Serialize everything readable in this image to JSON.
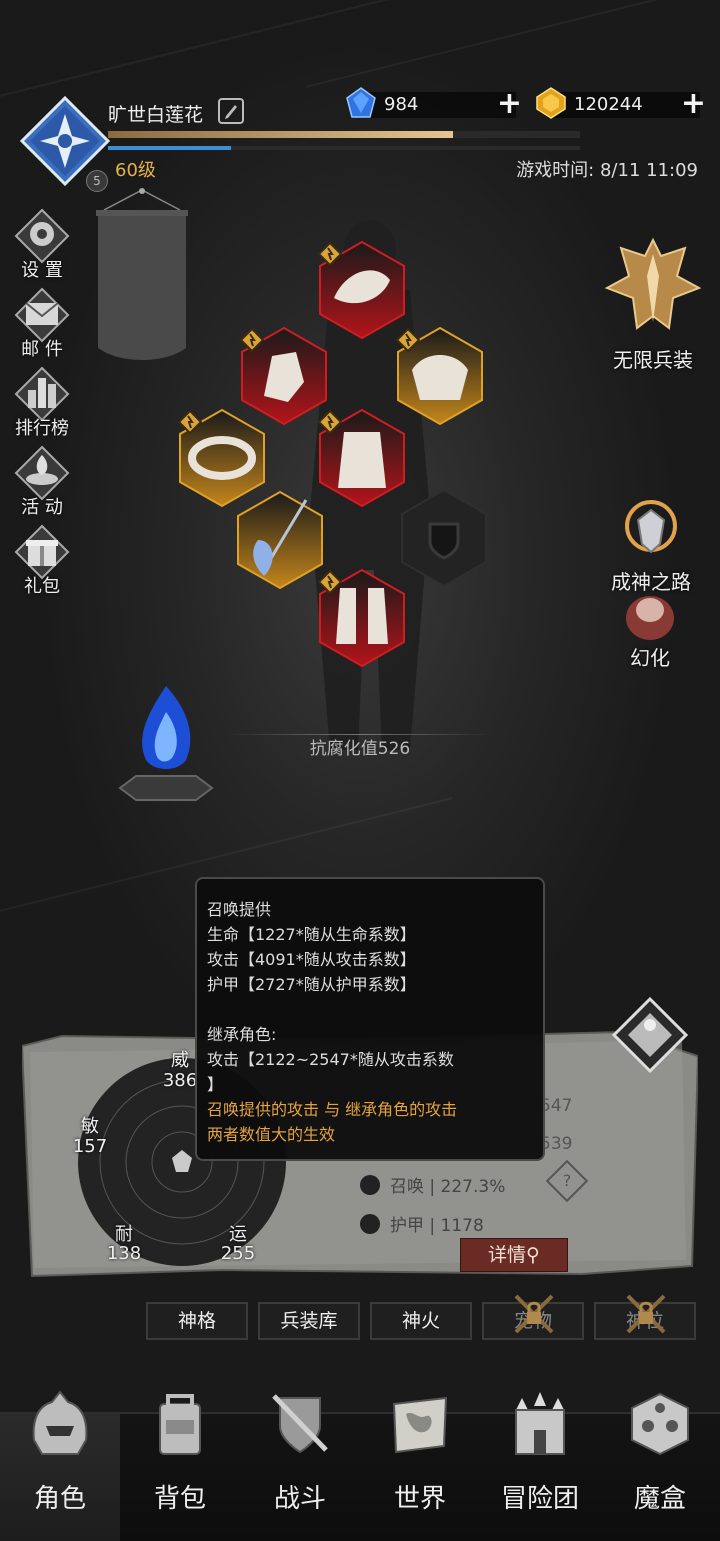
{
  "player": {
    "name": "旷世白莲花",
    "level_text": "60级",
    "badge": "5",
    "xp_fraction": 0.73,
    "mp_fraction": 0.26,
    "game_time": "游戏时间: 8/11 11:09"
  },
  "resources": {
    "diamonds": "984",
    "gold": "120244"
  },
  "left_menu": [
    {
      "label": "设 置",
      "icon": "gear-icon"
    },
    {
      "label": "邮 件",
      "icon": "mail-icon"
    },
    {
      "label": "排行榜",
      "icon": "ranking-icon"
    },
    {
      "label": "活 动",
      "icon": "event-icon"
    },
    {
      "label": "礼包",
      "icon": "gift-icon"
    }
  ],
  "right_menu": [
    {
      "label": "无限兵装",
      "icon": "infinite-arms-emblem"
    },
    {
      "label": "成神之路",
      "icon": "godhood-path-icon"
    },
    {
      "label": "幻化",
      "icon": "transmog-icon"
    }
  ],
  "equipment": {
    "corruption_resistance": "抗腐化值526"
  },
  "tooltip": {
    "title": "召唤提供",
    "line1": "生命【1227*随从生命系数】",
    "line2": "攻击【4091*随从攻击系数】",
    "line3": "护甲【2727*随从护甲系数】",
    "inherit_title": "继承角色:",
    "inherit_line1": "攻击【2122~2547*随从攻击系数",
    "inherit_line2": "】",
    "note1": "召唤提供的攻击 与 继承角色的攻击",
    "note2": "两者数值大的生效"
  },
  "stats": {
    "wei_label": "威",
    "wei_value": "386",
    "min_label": "敏",
    "min_value": "157",
    "nai_label": "耐",
    "nai_value": "138",
    "yun_label": "运",
    "yun_value": "255",
    "partial_1": "547",
    "partial_2": "539",
    "summon_label": "召唤 | 227.3%",
    "armor_label": "护甲 | 1178",
    "help": "?",
    "detail_button": "详情"
  },
  "tabs": [
    {
      "label": "神格",
      "locked": false
    },
    {
      "label": "兵装库",
      "locked": false
    },
    {
      "label": "神火",
      "locked": false
    },
    {
      "label": "宠物",
      "locked": true
    },
    {
      "label": "神位",
      "locked": true
    }
  ],
  "bottom_nav": [
    {
      "label": "角色",
      "icon": "helmet-icon",
      "active": true
    },
    {
      "label": "背包",
      "icon": "backpack-icon"
    },
    {
      "label": "战斗",
      "icon": "swords-shield-icon"
    },
    {
      "label": "世界",
      "icon": "map-scroll-icon"
    },
    {
      "label": "冒险团",
      "icon": "castle-icon"
    },
    {
      "label": "魔盒",
      "icon": "magic-cube-icon"
    }
  ],
  "colors": {
    "accent_gold": "#e3b34a",
    "rare_red": "#c8161b",
    "epic_gold": "#d99c22",
    "detail_button": "#6a2b25"
  }
}
